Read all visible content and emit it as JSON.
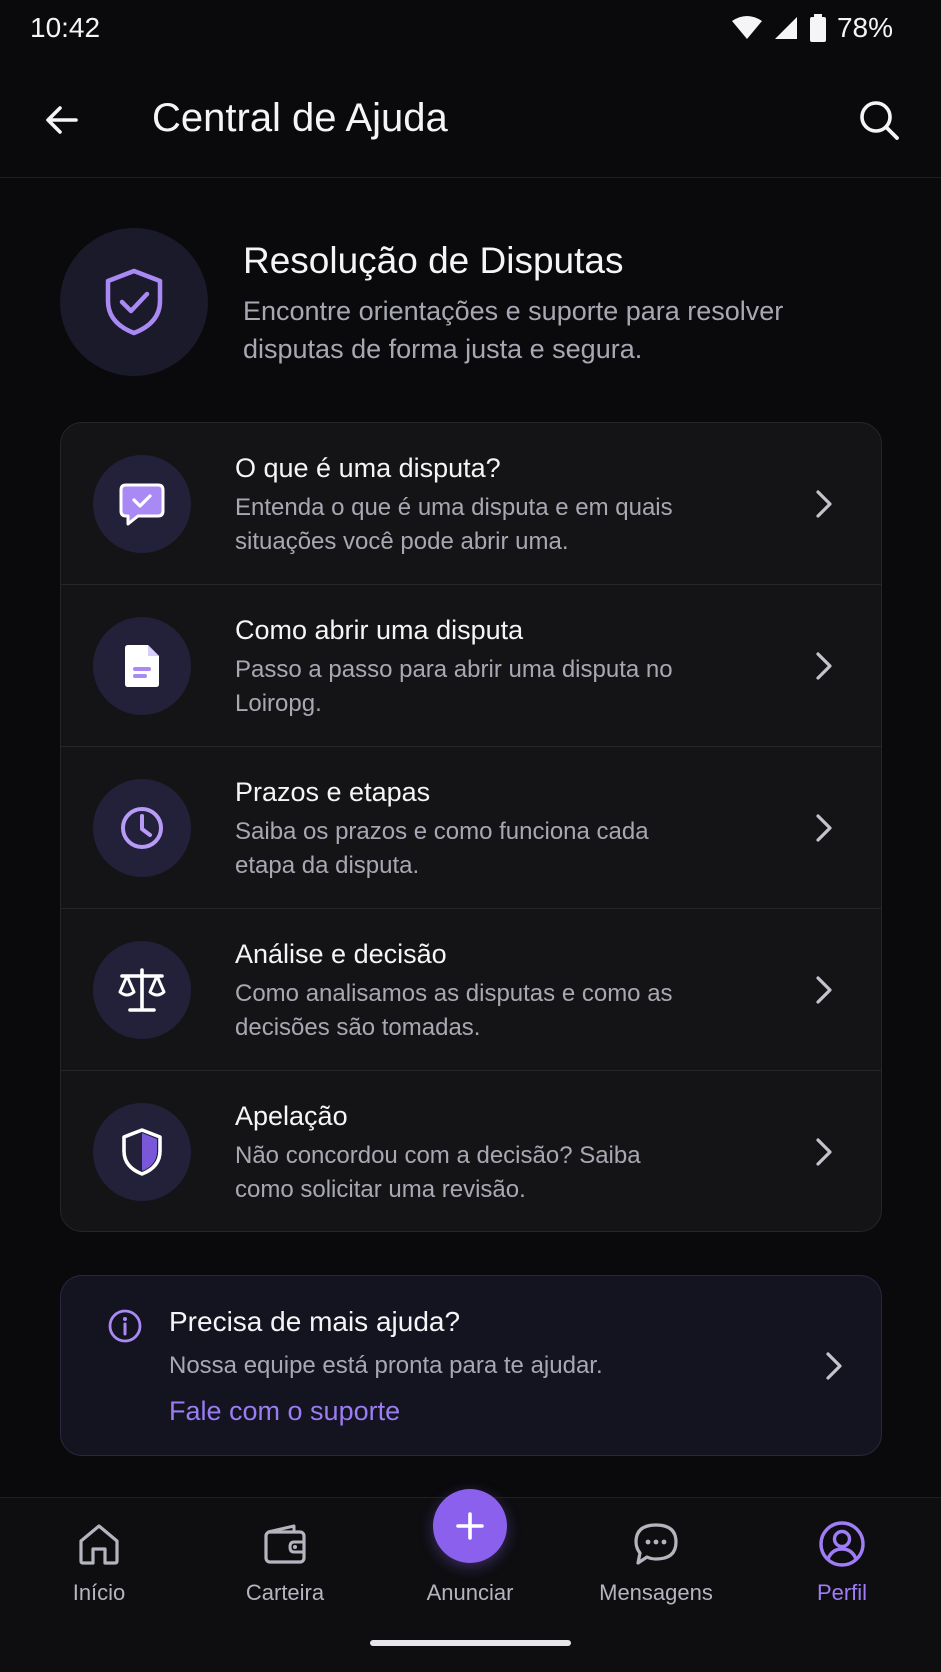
{
  "status_bar": {
    "time": "10:42",
    "battery_percent": "78%",
    "icons": [
      "wifi-icon",
      "signal-icon",
      "battery-icon"
    ]
  },
  "app_bar": {
    "title": "Central de Ajuda",
    "back_icon": "arrow-left-icon",
    "search_icon": "search-icon"
  },
  "hero": {
    "icon": "shield-check-icon",
    "title": "Resolução de Disputas",
    "description": "Encontre orientações e suporte para resolver disputas de forma justa e segura."
  },
  "topics": [
    {
      "icon": "chat-bubble-check-icon",
      "title": "O que é uma disputa?",
      "description": "Entenda o que é uma disputa e em quais situações você pode abrir uma."
    },
    {
      "icon": "document-icon",
      "title": "Como abrir uma disputa",
      "description": "Passo a passo para abrir uma disputa no Loiropg."
    },
    {
      "icon": "clock-icon",
      "title": "Prazos e etapas",
      "description": "Saiba os prazos e como funciona cada etapa da disputa."
    },
    {
      "icon": "scales-icon",
      "title": "Análise e decisão",
      "description": "Como analisamos as disputas e como as decisões são tomadas."
    },
    {
      "icon": "shield-half-icon",
      "title": "Apelação",
      "description": "Não concordou com a decisão? Saiba como solicitar uma revisão."
    }
  ],
  "help_card": {
    "icon": "info-icon",
    "title": "Precisa de mais ajuda?",
    "description": "Nossa equipe está pronta para te ajudar.",
    "link_label": "Fale com o suporte"
  },
  "bottom_nav": {
    "items": [
      {
        "label": "Início",
        "icon": "home-icon",
        "active": false
      },
      {
        "label": "Carteira",
        "icon": "wallet-icon",
        "active": false
      },
      {
        "label": "Anunciar",
        "icon": "plus-icon",
        "active": false
      },
      {
        "label": "Mensagens",
        "icon": "chat-dots-icon",
        "active": false
      },
      {
        "label": "Perfil",
        "icon": "user-circle-icon",
        "active": true
      }
    ]
  },
  "colors": {
    "background": "#0a0a0c",
    "accent": "#8a60ec",
    "accent_text": "#a07cf7",
    "card": "#141417"
  }
}
